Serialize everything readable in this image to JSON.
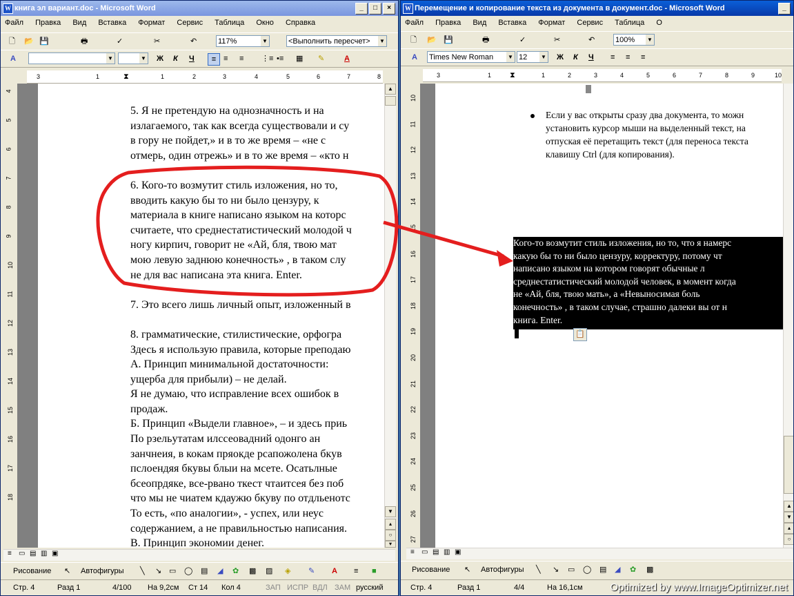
{
  "left_window": {
    "title": "книга эл вариант.doc - Microsoft Word",
    "menu": [
      "Файл",
      "Правка",
      "Вид",
      "Вставка",
      "Формат",
      "Сервис",
      "Таблица",
      "Окно",
      "Справка"
    ],
    "zoom": "117%",
    "style_combo": "<Выполнить пересчет>",
    "format_buttons": [
      "Ж",
      "К",
      "Ч"
    ],
    "ruler_numbers": [
      "3",
      "1",
      "1",
      "2",
      "3",
      "4",
      "5",
      "6",
      "7",
      "8"
    ],
    "vruler_numbers": [
      "4",
      "5",
      "6",
      "7",
      "8",
      "9",
      "10",
      "11",
      "12",
      "13",
      "14",
      "15",
      "16",
      "17",
      "18"
    ],
    "doc_lines": [
      "5. Я не претендую на однозначность и на",
      "излагаемого, так как всегда существовали и су",
      "в гору не пойдет,» и в то же время –  «не с",
      "отмерь, один отрежь» и в то же время –  «кто н",
      "",
      "6. Кого-то возмутит стиль изложения, но то,",
      "вводить какую бы то ни было цензуру, к",
      "материала в книге написано языком  на которс",
      "считаете, что среднестатистический молодой ч",
      "ногу кирпич, говорит не  «Ай, бля, твою мат",
      "мою левую заднюю конечность» , в таком слу",
      "не для вас написана эта книга. Enter.",
      "",
      "7. Это всего лишь личный опыт, изложенный в",
      "",
      "8. грамматические, стилистические, орфогра",
      "Здесь я использую правила, которые преподаю",
      "А. Принцип минимальной достаточности:",
      "ущерба для прибыли) – не делай.",
      "Я не думаю, что исправление всех ошибок в",
      "продаж.",
      "Б. Принцип «Выдели главное», – и здесь приь",
      "По рзельутатам илссеовадний одонго ан",
      "занчнеия, в кокам пряокде рсапожолена бкув",
      "пслоендяя бкувы блыи на мсете. Осатьлные",
      "бсеопрдяке, все-рвано ткест чтаитсея без поб",
      "что мы не чиатем кдаужю бкуву по отдльенотс",
      "То есть, «по аналогии», -  успех, или неус",
      "содержанием, а не правильностью написания.",
      "В. Принцип экономии денег."
    ],
    "drawbar": {
      "draw": "Рисование",
      "autoshapes": "Автофигуры"
    },
    "status": [
      "Стр. 4",
      "Разд 1",
      "4/100",
      "На 9,2см",
      "Ст 14",
      "Кол 4",
      "ЗАП",
      "ИСПР",
      "ВДЛ",
      "ЗАМ",
      "русский"
    ]
  },
  "right_window": {
    "title": "Перемещение и копирование текста из документа в документ.doc - Microsoft Word",
    "menu": [
      "Файл",
      "Правка",
      "Вид",
      "Вставка",
      "Формат",
      "Сервис",
      "Таблица",
      "О"
    ],
    "zoom": "100%",
    "font_name": "Times New Roman",
    "font_size": "12",
    "format_buttons": [
      "Ж",
      "К",
      "Ч"
    ],
    "ruler_numbers": [
      "3",
      "1",
      "1",
      "2",
      "3",
      "4",
      "5",
      "6",
      "7",
      "8",
      "9",
      "10"
    ],
    "vruler_numbers": [
      "10",
      "11",
      "12",
      "13",
      "14",
      "15",
      "16",
      "17",
      "18",
      "19",
      "20",
      "21",
      "22",
      "23",
      "24",
      "25",
      "26",
      "27"
    ],
    "bullet_text": [
      "Если у вас открыты сразу два документа, то можн",
      "установить курсор мыши на выделенный текст, на",
      "отпуская её перетащить текст (для переноса текста",
      "клавишу Ctrl (для копирования)."
    ],
    "pasted_lines": [
      "Кого-то возмутит стиль изложения, но то, что я намерс",
      "какую бы то ни было цензуру, корректуру, потому чт",
      "написано языком   на котором говорят обычные   л",
      "среднестатистический молодой человек, в момент когда",
      "не  «Ай, бля, твою мать», а  «Невыносимая боль",
      "конечность» , в таком случае, страшно далеки вы от н",
      "книга. Enter."
    ],
    "drawbar": {
      "draw": "Рисование",
      "autoshapes": "Автофигуры"
    },
    "status": [
      "Стр. 4",
      "Разд 1",
      "4/4",
      "На 16,1см"
    ],
    "watermark": "Optimized by www.ImageOptimizer.net"
  },
  "colors": {
    "annotation": "#e41e1e",
    "title_active": "#0a5fd8",
    "title_inactive": "#8aa6e6"
  }
}
